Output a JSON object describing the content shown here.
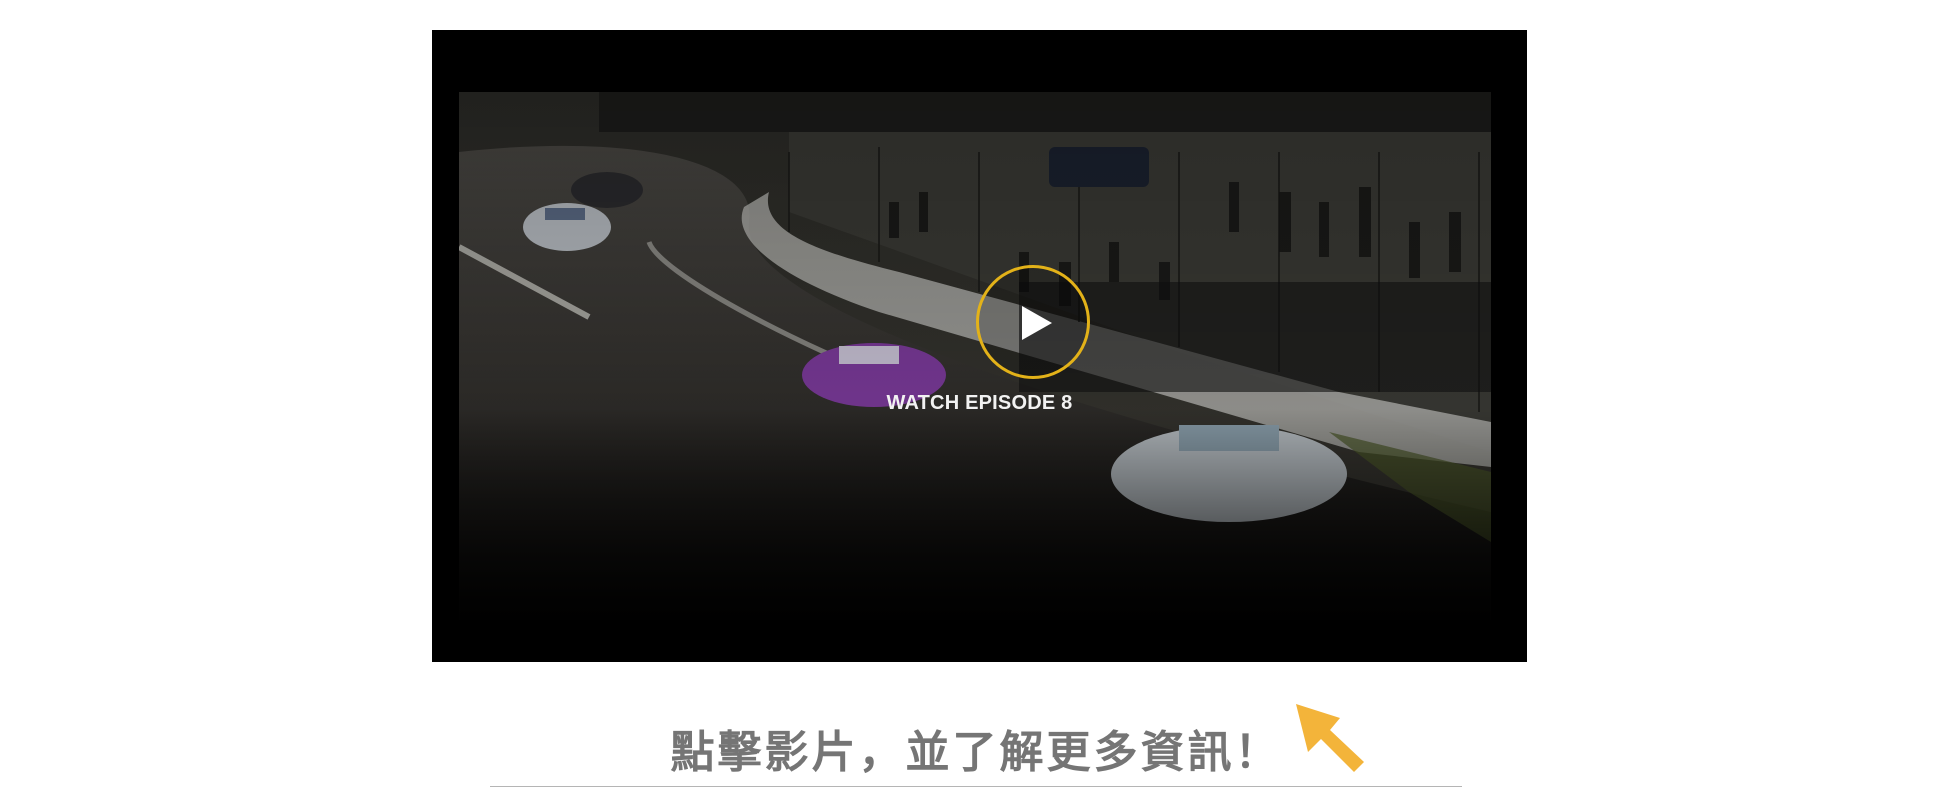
{
  "video": {
    "overlay_label": "WATCH EPISODE 8",
    "play_icon": "play-icon",
    "accent_color": "#e3b219"
  },
  "caption": {
    "text": "點擊影片，並了解更多資訊！",
    "pointer_icon": "cursor-arrow-icon",
    "pointer_color": "#f3b43a"
  }
}
